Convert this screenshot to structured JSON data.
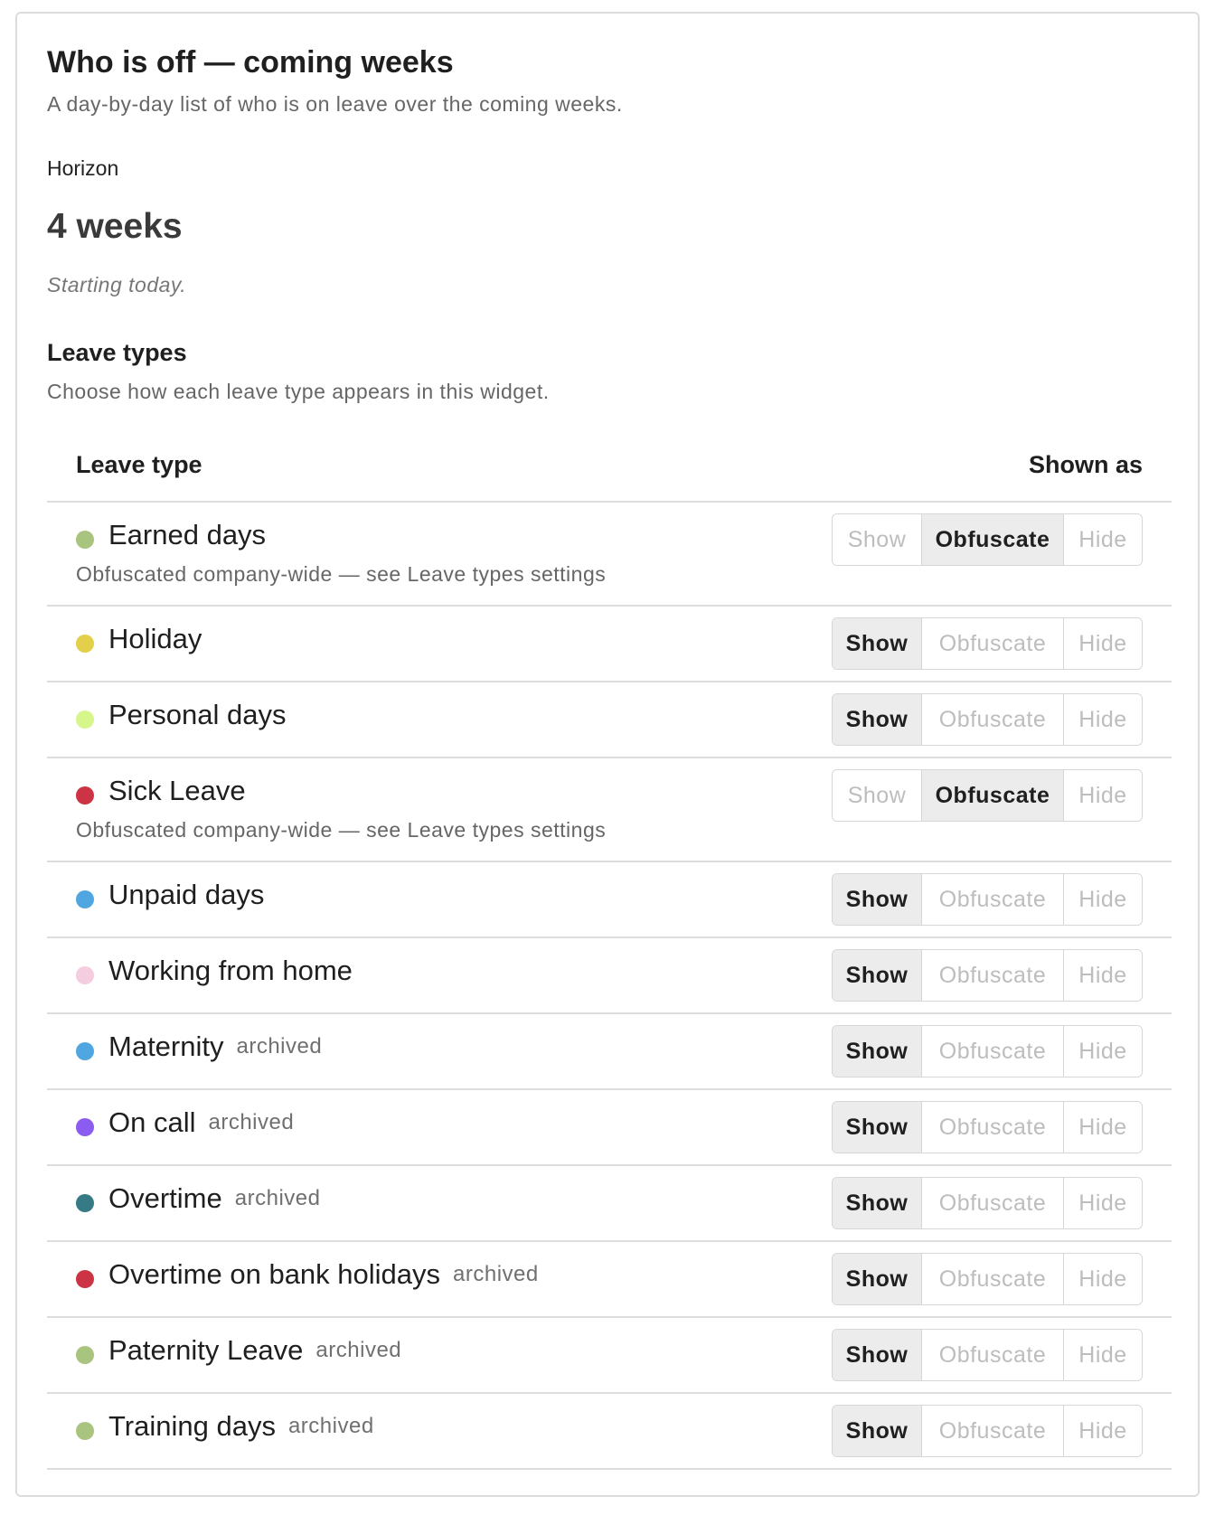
{
  "header": {
    "title": "Who is off — coming weeks",
    "subtitle": "A day-by-day list of who is on leave over the coming weeks."
  },
  "horizon": {
    "label": "Horizon",
    "value": "4 weeks",
    "note": "Starting today."
  },
  "leave_section": {
    "title": "Leave types",
    "description": "Choose how each leave type appears in this widget.",
    "columns": {
      "left": "Leave type",
      "right": "Shown as"
    },
    "options": [
      "Show",
      "Obfuscate",
      "Hide"
    ],
    "archived_label": "archived",
    "rows": [
      {
        "name": "Earned days",
        "color": "#a9c47f",
        "archived": false,
        "selected": "Obfuscate",
        "locked": true,
        "note": "Obfuscated company-wide — see Leave types settings"
      },
      {
        "name": "Holiday",
        "color": "#e3cf4a",
        "archived": false,
        "selected": "Show",
        "locked": false,
        "note": ""
      },
      {
        "name": "Personal days",
        "color": "#d6f58a",
        "archived": false,
        "selected": "Show",
        "locked": false,
        "note": ""
      },
      {
        "name": "Sick Leave",
        "color": "#cc3344",
        "archived": false,
        "selected": "Obfuscate",
        "locked": true,
        "note": "Obfuscated company-wide — see Leave types settings"
      },
      {
        "name": "Unpaid days",
        "color": "#4fa6e0",
        "archived": false,
        "selected": "Show",
        "locked": false,
        "note": ""
      },
      {
        "name": "Working from home",
        "color": "#f5cde0",
        "archived": false,
        "selected": "Show",
        "locked": false,
        "note": ""
      },
      {
        "name": "Maternity",
        "color": "#4fa6e0",
        "archived": true,
        "selected": "Show",
        "locked": false,
        "note": ""
      },
      {
        "name": "On call",
        "color": "#8b5cf0",
        "archived": true,
        "selected": "Show",
        "locked": false,
        "note": ""
      },
      {
        "name": "Overtime",
        "color": "#357a84",
        "archived": true,
        "selected": "Show",
        "locked": false,
        "note": ""
      },
      {
        "name": "Overtime on bank holidays",
        "color": "#cc3344",
        "archived": true,
        "selected": "Show",
        "locked": false,
        "note": ""
      },
      {
        "name": "Paternity Leave",
        "color": "#a9c47f",
        "archived": true,
        "selected": "Show",
        "locked": false,
        "note": ""
      },
      {
        "name": "Training days",
        "color": "#a9c47f",
        "archived": true,
        "selected": "Show",
        "locked": false,
        "note": ""
      }
    ]
  }
}
